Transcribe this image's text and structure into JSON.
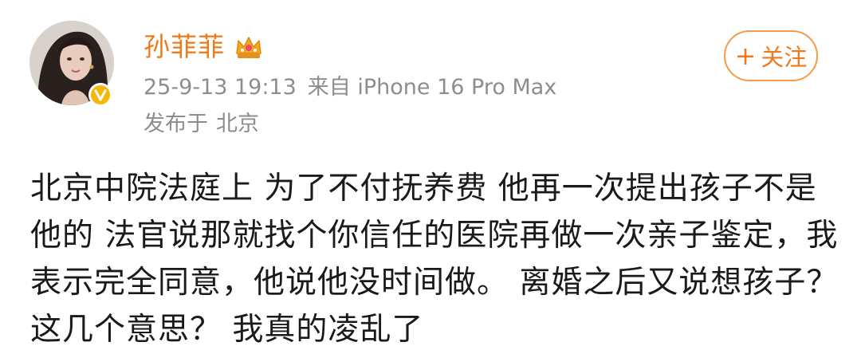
{
  "post": {
    "author": {
      "name": "孙菲菲",
      "badges": [
        "crown-icon",
        "verified-icon"
      ]
    },
    "timestamp": "25-9-13 19:13",
    "source": "来自 iPhone 16 Pro Max",
    "location_label": "发布于",
    "location": "北京",
    "follow_label": "关注",
    "follow_plus": "+",
    "content": "北京中院法庭上 为了不付抚养费 他再一次提出孩子不是他的 法官说那就找个你信任的医院再做一次亲子鉴定，我表示完全同意，他说他没时间做。 离婚之后又说想孩子？ 这几个意思？ 我真的凌乱了"
  },
  "colors": {
    "accent": "#f07a1a",
    "follow_border": "#f59a4a",
    "meta_text": "#8d8d8d",
    "body_text": "#1a1a1a",
    "verified": "#f5b70a"
  }
}
